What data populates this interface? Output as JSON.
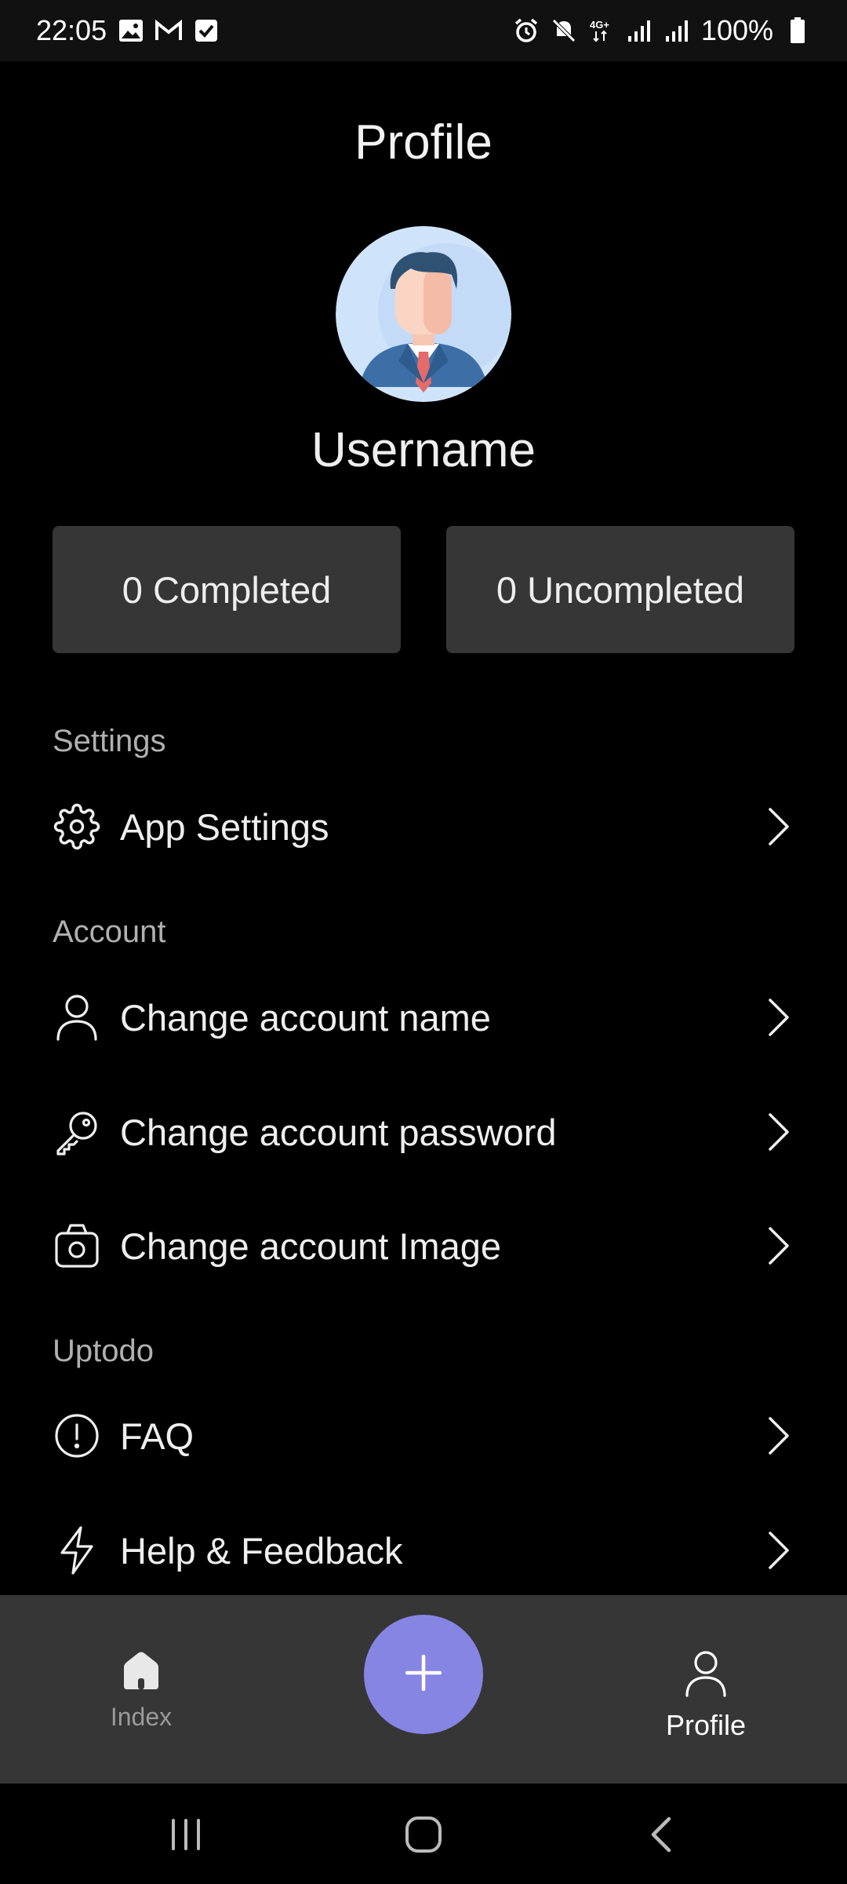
{
  "status_bar": {
    "time": "22:05",
    "battery": "100%",
    "icons_left": [
      "gallery-icon",
      "gmail-icon",
      "checkbox-icon"
    ],
    "icons_right": [
      "alarm-icon",
      "mute-icon",
      "4g-icon",
      "signal-icon",
      "signal-icon",
      "battery-icon"
    ]
  },
  "header": {
    "title": "Profile"
  },
  "profile": {
    "username": "Username"
  },
  "stats": {
    "completed": "0 Completed",
    "uncompleted": "0 Uncompleted"
  },
  "sections": {
    "settings": {
      "title": "Settings",
      "items": [
        {
          "label": "App Settings",
          "icon": "gear-icon"
        }
      ]
    },
    "account": {
      "title": "Account",
      "items": [
        {
          "label": "Change account name",
          "icon": "user-icon"
        },
        {
          "label": "Change account password",
          "icon": "key-icon"
        },
        {
          "label": "Change account Image",
          "icon": "camera-icon"
        }
      ]
    },
    "uptodo": {
      "title": "Uptodo",
      "items": [
        {
          "label": "FAQ",
          "icon": "info-circle-icon"
        },
        {
          "label": "Help & Feedback",
          "icon": "lightning-icon"
        }
      ]
    }
  },
  "bottom_nav": {
    "index_label": "Index",
    "profile_label": "Profile",
    "fab_icon": "plus-icon"
  },
  "colors": {
    "background": "#000000",
    "card": "#363636",
    "accent": "#8785e3",
    "section_title": "#b0b0b0"
  }
}
